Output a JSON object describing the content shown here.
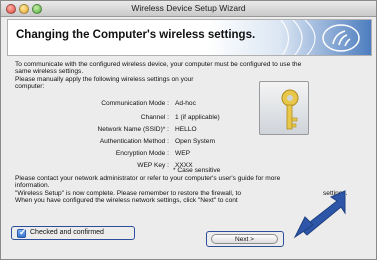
{
  "window": {
    "title": "Wireless Device Setup Wizard"
  },
  "banner": {
    "title": "Changing the Computer's wireless settings."
  },
  "intro": {
    "line1": "To communicate with the configured wireless device, your computer must be configured to use the",
    "line2": "same wireless settings.",
    "line3": "Please manually apply the following wireless settings on your",
    "line4": "computer:"
  },
  "settings": [
    {
      "label": "Communication Mode :",
      "value": "Ad-hoc"
    },
    {
      "label": "Channel :",
      "value": "1    (if applicable)"
    },
    {
      "label": "Network Name (SSID)* :",
      "value": "HELLO"
    },
    {
      "label": "Authentication Method :",
      "value": "Open System"
    },
    {
      "label": "Encryption Mode :",
      "value": "WEP"
    },
    {
      "label": "WEP Key :",
      "value": "XXXX"
    }
  ],
  "case_note": "* Case sensitive",
  "contact": {
    "line1": "Please contact your network administrator or refer to your computer's user's guide for more",
    "line2": "information.",
    "line3": "\"Wireless Setup\" is now complete. Please remember to restore the firewall, to",
    "line3b": "settings.",
    "line4": "When you have configured the wireless network settings, click \"Next\" to cont"
  },
  "checkbox": {
    "label": "Checked and confirmed",
    "checked": true
  },
  "next_button": {
    "label": "Next >"
  },
  "colors": {
    "highlight": "#2b4f9a",
    "arrow": "#2d56a8",
    "banner_accent": "#4d7dbf"
  }
}
